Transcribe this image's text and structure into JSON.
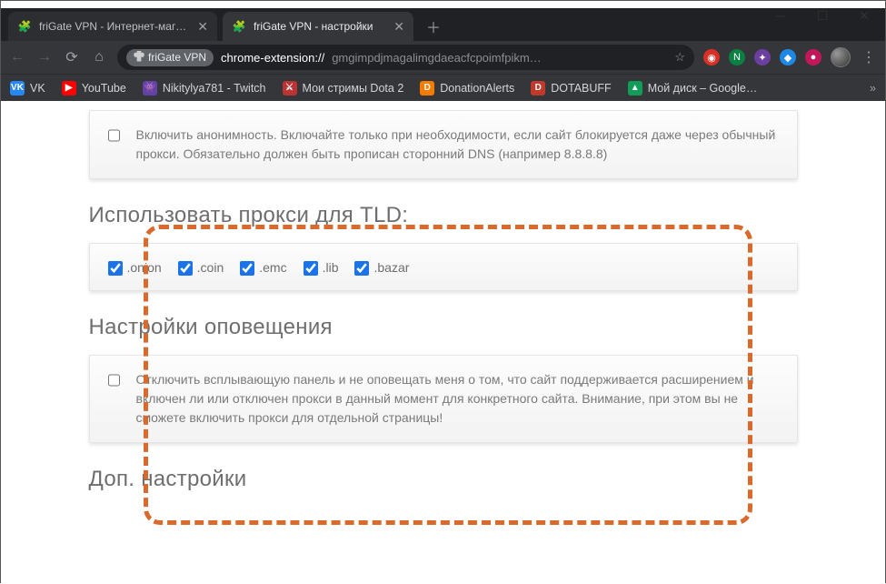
{
  "window": {
    "tabs": [
      {
        "title": "friGate VPN - Интернет-магазин",
        "favicon": "🧩",
        "active": false
      },
      {
        "title": "friGate VPN - настройки",
        "favicon": "🧩",
        "active": true
      }
    ]
  },
  "omnibox": {
    "pill": "friGate VPN",
    "url_scheme": "chrome-extension://",
    "url_rest": "gmgimpdjmagalimgdaeacfcpoimfpikm…"
  },
  "bookmarks": [
    {
      "icon": "VK",
      "bg": "#2787f5",
      "label": "VK"
    },
    {
      "icon": "▶",
      "bg": "#ff0000",
      "label": "YouTube"
    },
    {
      "icon": "👾",
      "bg": "#6441a5",
      "label": "Nikitylya781 - Twitch"
    },
    {
      "icon": "⚔",
      "bg": "#b33",
      "label": "Мои стримы Dota 2"
    },
    {
      "icon": "D",
      "bg": "#f57c00",
      "label": "DonationAlerts"
    },
    {
      "icon": "D",
      "bg": "#c0392b",
      "label": "DOTABUFF"
    },
    {
      "icon": "▲",
      "bg": "#0f9d58",
      "label": "Мой диск – Google…"
    }
  ],
  "ext_icons": [
    {
      "bg": "#d93025",
      "glyph": "◉"
    },
    {
      "bg": "#0b8043",
      "glyph": "N"
    },
    {
      "bg": "#6b3fa0",
      "glyph": "✦"
    },
    {
      "bg": "#1e88e5",
      "glyph": "◆"
    },
    {
      "bg": "#c2185b",
      "glyph": "●"
    }
  ],
  "page": {
    "card_anon": "Включить анонимность. Включайте только при необходимости, если сайт блокируется даже через обычный прокси. Обязательно должен быть прописан сторонний DNS (например 8.8.8.8)",
    "title_tld": "Использовать прокси для TLD:",
    "tlds": [
      ".onion",
      ".coin",
      ".emc",
      ".lib",
      ".bazar"
    ],
    "title_notify": "Настройки оповещения",
    "card_notify": "Отключить всплывающую панель и не оповещать меня о том, что сайт поддерживается расширением и включен ли или отключен прокси в данный момент для конкретного сайта. Внимание, при этом вы не сможете включить прокси для отдельной страницы!",
    "title_extra": "Доп. настройки"
  }
}
